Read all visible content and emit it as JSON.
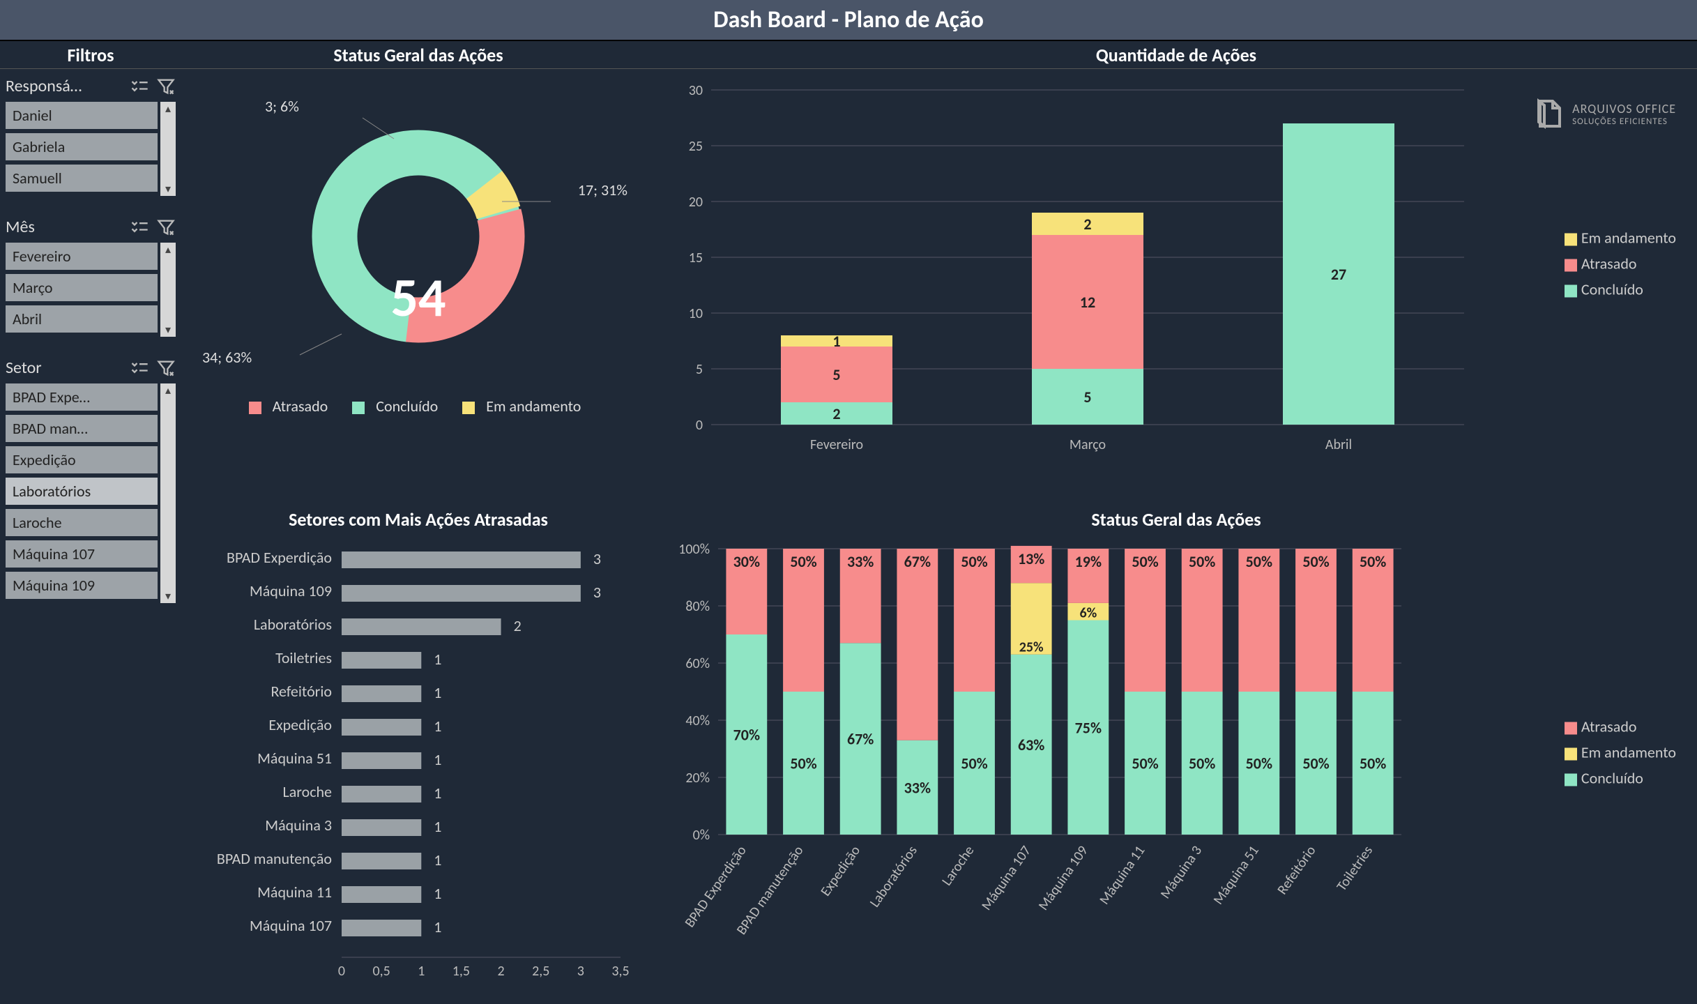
{
  "title": "Dash Board - Plano de Ação",
  "headers": {
    "filtros": "Filtros",
    "status_geral": "Status Geral das Ações",
    "quantidade": "Quantidade de Ações",
    "setores_atrasadas": "Setores com Mais Ações Atrasadas",
    "status_geral2": "Status Geral das Ações"
  },
  "brand": {
    "line1": "ARQUIVOS OFFICE",
    "line2": "SOLUÇÕES EFICIENTES"
  },
  "slicers": {
    "responsavel": {
      "label": "Responsá…",
      "items": [
        "Daniel",
        "Gabriela",
        "Samuell"
      ]
    },
    "mes": {
      "label": "Mês",
      "items": [
        "Fevereiro",
        "Março",
        "Abril"
      ]
    },
    "setor": {
      "label": "Setor",
      "items": [
        "BPAD Expe…",
        "BPAD man…",
        "Expedição",
        "Laboratórios",
        "Laroche",
        "Máquina 107",
        "Máquina 109"
      ]
    }
  },
  "donut": {
    "total": "54",
    "labels": {
      "atrasado": "17; 31%",
      "concluido": "34; 63%",
      "andamento": "3; 6%"
    },
    "legend": {
      "atrasado": "Atrasado",
      "concluido": "Concluído",
      "andamento": "Em andamento"
    }
  },
  "qty_legend": {
    "andamento": "Em andamento",
    "atrasado": "Atrasado",
    "concluido": "Concluído"
  },
  "status2_legend": {
    "atrasado": "Atrasado",
    "andamento": "Em andamento",
    "concluido": "Concluído"
  },
  "chart_data": [
    {
      "type": "pie",
      "title": "Status Geral das Ações",
      "series": [
        {
          "name": "Atrasado",
          "value": 17,
          "pct": 31
        },
        {
          "name": "Concluído",
          "value": 34,
          "pct": 63
        },
        {
          "name": "Em andamento",
          "value": 3,
          "pct": 6
        }
      ],
      "total": 54
    },
    {
      "type": "bar",
      "title": "Quantidade de Ações",
      "stacked": true,
      "categories": [
        "Fevereiro",
        "Março",
        "Abril"
      ],
      "series": [
        {
          "name": "Concluído",
          "values": [
            2,
            5,
            27
          ]
        },
        {
          "name": "Atrasado",
          "values": [
            5,
            12,
            0
          ]
        },
        {
          "name": "Em andamento",
          "values": [
            1,
            2,
            0
          ]
        }
      ],
      "ylim": [
        0,
        30
      ],
      "yticks": [
        0,
        5,
        10,
        15,
        20,
        25,
        30
      ]
    },
    {
      "type": "bar",
      "orientation": "horizontal",
      "title": "Setores com Mais Ações Atrasadas",
      "categories": [
        "BPAD Experdição",
        "Máquina 109",
        "Laboratórios",
        "Toiletries",
        "Refeitório",
        "Expedição",
        "Máquina 51",
        "Laroche",
        "Máquina 3",
        "BPAD manutenção",
        "Máquina 11",
        "Máquina 107"
      ],
      "values": [
        3,
        3,
        2,
        1,
        1,
        1,
        1,
        1,
        1,
        1,
        1,
        1
      ],
      "xlim": [
        0,
        3.5
      ],
      "xticks": [
        0,
        0.5,
        1,
        1.5,
        2,
        2.5,
        3,
        3.5
      ]
    },
    {
      "type": "bar",
      "title": "Status Geral das Ações (%)",
      "stacked": true,
      "percent": true,
      "categories": [
        "BPAD Experdição",
        "BPAD manutenção",
        "Expedição",
        "Laboratórios",
        "Laroche",
        "Máquina 107",
        "Máquina 109",
        "Máquina 11",
        "Máquina 3",
        "Máquina 51",
        "Refeitório",
        "Toiletries"
      ],
      "series": [
        {
          "name": "Concluído",
          "values": [
            70,
            50,
            67,
            33,
            50,
            63,
            75,
            50,
            50,
            50,
            50,
            50
          ]
        },
        {
          "name": "Em andamento",
          "values": [
            0,
            0,
            0,
            0,
            0,
            25,
            6,
            0,
            0,
            0,
            0,
            0
          ]
        },
        {
          "name": "Atrasado",
          "values": [
            30,
            50,
            33,
            67,
            50,
            13,
            19,
            50,
            50,
            50,
            50,
            50
          ]
        }
      ],
      "ylim": [
        0,
        100
      ],
      "yticks": [
        0,
        20,
        40,
        60,
        80,
        100
      ]
    }
  ]
}
